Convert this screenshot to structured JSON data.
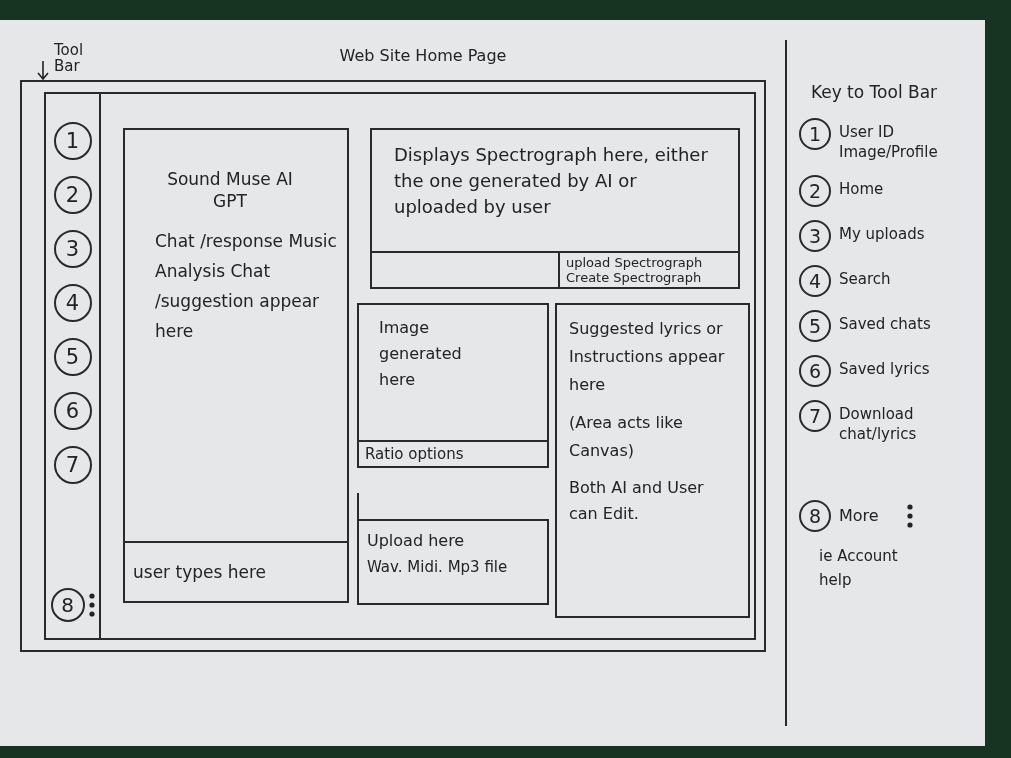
{
  "page_title": "Web Site Home Page",
  "toolbar": {
    "label": "Tool Bar",
    "items": [
      {
        "number": "1"
      },
      {
        "number": "2"
      },
      {
        "number": "3"
      },
      {
        "number": "4"
      },
      {
        "number": "5"
      },
      {
        "number": "6"
      },
      {
        "number": "7"
      }
    ],
    "more_button": {
      "number": "8"
    }
  },
  "chat_panel": {
    "title": "Sound Muse AI GPT",
    "description": "Chat /response Music Analysis Chat /suggestion appear here",
    "input": {
      "placeholder": "user types here"
    }
  },
  "spectrograph_panel": {
    "text": "Displays Spectrograph here, either the one generated by AI or uploaded by user",
    "buttons": [
      {
        "label": "upload Spectrograph"
      },
      {
        "label": "Create Spectrograph"
      }
    ]
  },
  "image_panel": {
    "text": "Image generated here",
    "ratio_options": "Ratio options"
  },
  "upload_panel": {
    "title": "Upload here",
    "formats": "Wav. Midi. Mp3 file"
  },
  "lyrics_panel": {
    "text": "Suggested lyrics or Instructions appear here",
    "note": "(Area acts like Canvas)",
    "edit_note": "Both AI and User can Edit."
  },
  "key": {
    "title": "Key to Tool Bar",
    "items": [
      {
        "number": "1",
        "label": "User ID Image/Profile"
      },
      {
        "number": "2",
        "label": "Home"
      },
      {
        "number": "3",
        "label": "My uploads"
      },
      {
        "number": "4",
        "label": "Search"
      },
      {
        "number": "5",
        "label": "Saved chats"
      },
      {
        "number": "6",
        "label": "Saved lyrics"
      },
      {
        "number": "7",
        "label": "Download chat/lyrics"
      }
    ],
    "more": {
      "number": "8",
      "label": "More",
      "note": "ie Account help"
    }
  }
}
